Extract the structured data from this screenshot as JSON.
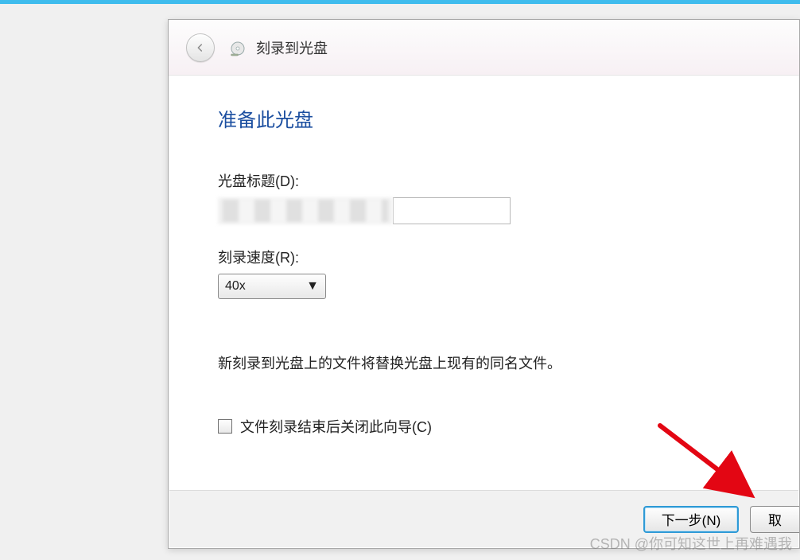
{
  "header": {
    "title": "刻录到光盘"
  },
  "main": {
    "heading": "准备此光盘",
    "disc_title_label": "光盘标题(D):",
    "disc_title_value": "",
    "speed_label": "刻录速度(R):",
    "speed_value": "40x",
    "info_text": "新刻录到光盘上的文件将替换光盘上现有的同名文件。",
    "close_checkbox_label": "文件刻录结束后关闭此向导(C)",
    "close_checkbox_checked": false
  },
  "buttons": {
    "next": "下一步(N)",
    "cancel": "取"
  },
  "watermark": "CSDN @你可知这世上再难遇我"
}
